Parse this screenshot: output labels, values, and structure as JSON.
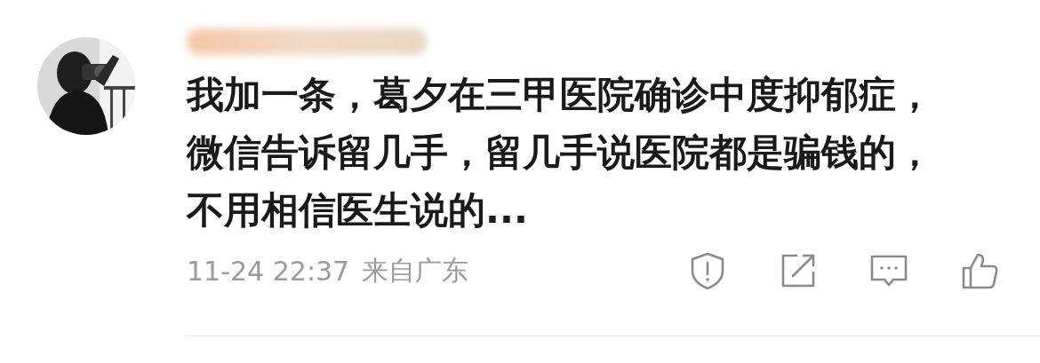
{
  "comment": {
    "text": "我加一条，葛夕在三甲医院确诊中度抑郁症，微信告诉留几手，留几手说医院都是骗钱的，不用相信医生说的...",
    "time": "11-24 22:37",
    "location": "来自广东",
    "actions": [
      {
        "kind": "report"
      },
      {
        "kind": "share"
      },
      {
        "kind": "comment"
      },
      {
        "kind": "like"
      }
    ]
  }
}
